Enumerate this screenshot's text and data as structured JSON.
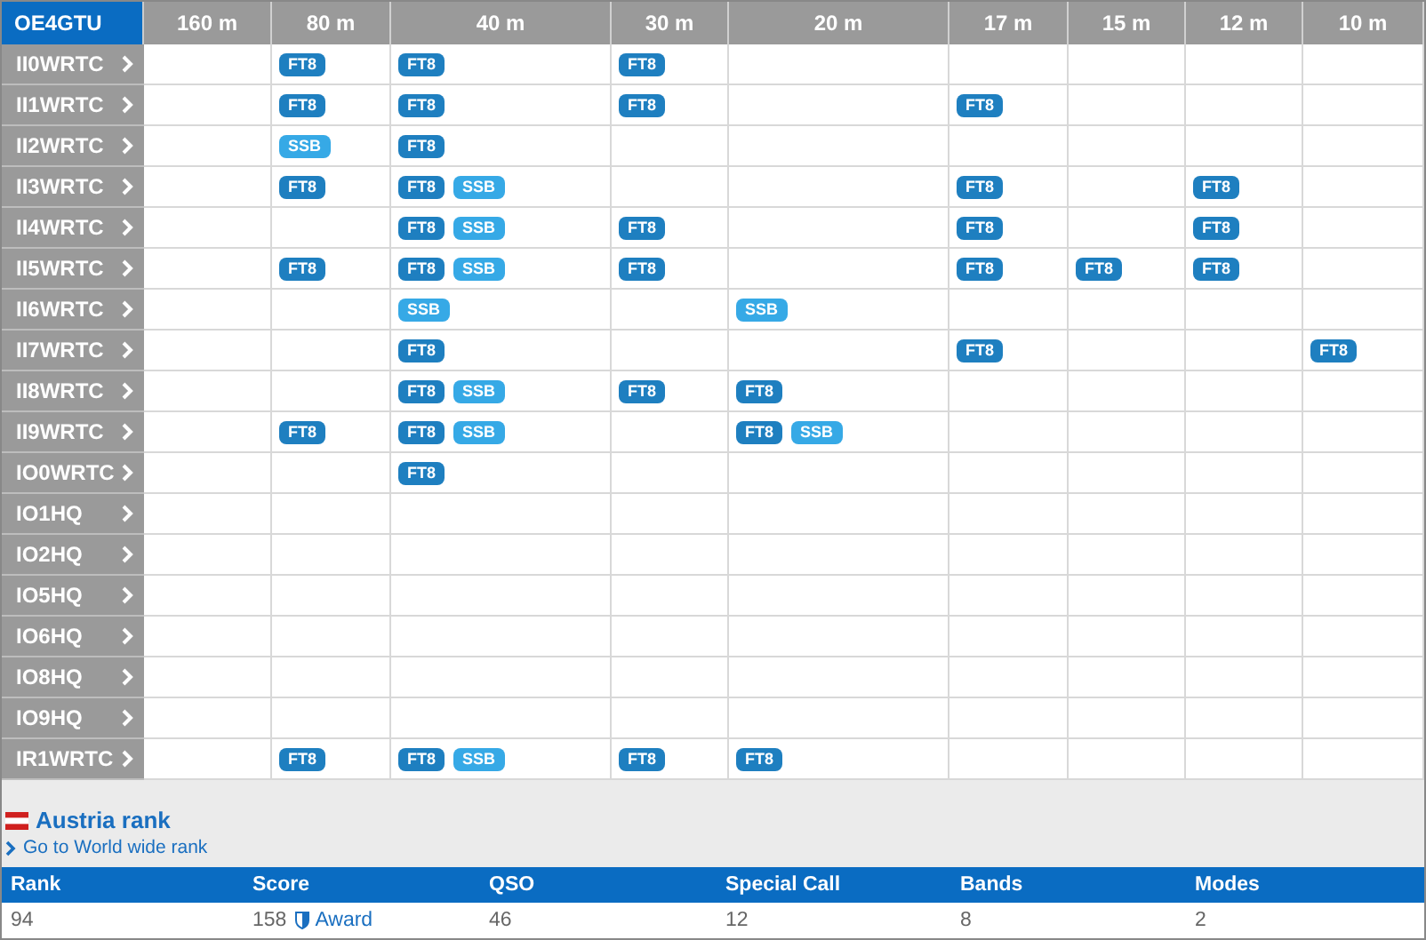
{
  "table": {
    "corner": "OE4GTU",
    "bands": [
      "160 m",
      "80 m",
      "40 m",
      "30 m",
      "20 m",
      "17 m",
      "15 m",
      "12 m",
      "10 m"
    ],
    "rows": [
      {
        "call": "II0WRTC",
        "cells": [
          [],
          [
            {
              "label": "FT8",
              "kind": "ft8"
            }
          ],
          [
            {
              "label": "FT8",
              "kind": "ft8"
            }
          ],
          [
            {
              "label": "FT8",
              "kind": "ft8"
            }
          ],
          [],
          [],
          [],
          [],
          []
        ]
      },
      {
        "call": "II1WRTC",
        "cells": [
          [],
          [
            {
              "label": "FT8",
              "kind": "ft8"
            }
          ],
          [
            {
              "label": "FT8",
              "kind": "ft8"
            }
          ],
          [
            {
              "label": "FT8",
              "kind": "ft8"
            }
          ],
          [],
          [
            {
              "label": "FT8",
              "kind": "ft8"
            }
          ],
          [],
          [],
          []
        ]
      },
      {
        "call": "II2WRTC",
        "cells": [
          [],
          [
            {
              "label": "SSB",
              "kind": "ssb"
            }
          ],
          [
            {
              "label": "FT8",
              "kind": "ft8"
            }
          ],
          [],
          [],
          [],
          [],
          [],
          []
        ]
      },
      {
        "call": "II3WRTC",
        "cells": [
          [],
          [
            {
              "label": "FT8",
              "kind": "ft8"
            }
          ],
          [
            {
              "label": "FT8",
              "kind": "ft8"
            },
            {
              "label": "SSB",
              "kind": "ssb"
            }
          ],
          [],
          [],
          [
            {
              "label": "FT8",
              "kind": "ft8"
            }
          ],
          [],
          [
            {
              "label": "FT8",
              "kind": "ft8"
            }
          ],
          []
        ]
      },
      {
        "call": "II4WRTC",
        "cells": [
          [],
          [],
          [
            {
              "label": "FT8",
              "kind": "ft8"
            },
            {
              "label": "SSB",
              "kind": "ssb"
            }
          ],
          [
            {
              "label": "FT8",
              "kind": "ft8"
            }
          ],
          [],
          [
            {
              "label": "FT8",
              "kind": "ft8"
            }
          ],
          [],
          [
            {
              "label": "FT8",
              "kind": "ft8"
            }
          ],
          []
        ]
      },
      {
        "call": "II5WRTC",
        "cells": [
          [],
          [
            {
              "label": "FT8",
              "kind": "ft8"
            }
          ],
          [
            {
              "label": "FT8",
              "kind": "ft8"
            },
            {
              "label": "SSB",
              "kind": "ssb"
            }
          ],
          [
            {
              "label": "FT8",
              "kind": "ft8"
            }
          ],
          [],
          [
            {
              "label": "FT8",
              "kind": "ft8"
            }
          ],
          [
            {
              "label": "FT8",
              "kind": "ft8"
            }
          ],
          [
            {
              "label": "FT8",
              "kind": "ft8"
            }
          ],
          []
        ]
      },
      {
        "call": "II6WRTC",
        "cells": [
          [],
          [],
          [
            {
              "label": "SSB",
              "kind": "ssb"
            }
          ],
          [],
          [
            {
              "label": "SSB",
              "kind": "ssb"
            }
          ],
          [],
          [],
          [],
          []
        ]
      },
      {
        "call": "II7WRTC",
        "cells": [
          [],
          [],
          [
            {
              "label": "FT8",
              "kind": "ft8"
            }
          ],
          [],
          [],
          [
            {
              "label": "FT8",
              "kind": "ft8"
            }
          ],
          [],
          [],
          [
            {
              "label": "FT8",
              "kind": "ft8"
            }
          ]
        ]
      },
      {
        "call": "II8WRTC",
        "cells": [
          [],
          [],
          [
            {
              "label": "FT8",
              "kind": "ft8"
            },
            {
              "label": "SSB",
              "kind": "ssb"
            }
          ],
          [
            {
              "label": "FT8",
              "kind": "ft8"
            }
          ],
          [
            {
              "label": "FT8",
              "kind": "ft8"
            }
          ],
          [],
          [],
          [],
          []
        ]
      },
      {
        "call": "II9WRTC",
        "cells": [
          [],
          [
            {
              "label": "FT8",
              "kind": "ft8"
            }
          ],
          [
            {
              "label": "FT8",
              "kind": "ft8"
            },
            {
              "label": "SSB",
              "kind": "ssb"
            }
          ],
          [],
          [
            {
              "label": "FT8",
              "kind": "ft8"
            },
            {
              "label": "SSB",
              "kind": "ssb"
            }
          ],
          [],
          [],
          [],
          []
        ]
      },
      {
        "call": "IO0WRTC",
        "cells": [
          [],
          [],
          [
            {
              "label": "FT8",
              "kind": "ft8"
            }
          ],
          [],
          [],
          [],
          [],
          [],
          []
        ]
      },
      {
        "call": "IO1HQ",
        "cells": [
          [],
          [],
          [],
          [],
          [],
          [],
          [],
          [],
          []
        ]
      },
      {
        "call": "IO2HQ",
        "cells": [
          [],
          [],
          [],
          [],
          [],
          [],
          [],
          [],
          []
        ]
      },
      {
        "call": "IO5HQ",
        "cells": [
          [],
          [],
          [],
          [],
          [],
          [],
          [],
          [],
          []
        ]
      },
      {
        "call": "IO6HQ",
        "cells": [
          [],
          [],
          [],
          [],
          [],
          [],
          [],
          [],
          []
        ]
      },
      {
        "call": "IO8HQ",
        "cells": [
          [],
          [],
          [],
          [],
          [],
          [],
          [],
          [],
          []
        ]
      },
      {
        "call": "IO9HQ",
        "cells": [
          [],
          [],
          [],
          [],
          [],
          [],
          [],
          [],
          []
        ]
      },
      {
        "call": "IR1WRTC",
        "cells": [
          [],
          [
            {
              "label": "FT8",
              "kind": "ft8"
            }
          ],
          [
            {
              "label": "FT8",
              "kind": "ft8"
            },
            {
              "label": "SSB",
              "kind": "ssb"
            }
          ],
          [
            {
              "label": "FT8",
              "kind": "ft8"
            }
          ],
          [
            {
              "label": "FT8",
              "kind": "ft8"
            }
          ],
          [],
          [],
          [],
          []
        ]
      }
    ]
  },
  "rank": {
    "title": "Austria rank",
    "link": "Go to World wide rank",
    "columns": [
      "Rank",
      "Score",
      "QSO",
      "Special Call",
      "Bands",
      "Modes"
    ],
    "values": [
      "94",
      "158",
      "46",
      "12",
      "8",
      "2"
    ],
    "award": "Award"
  }
}
